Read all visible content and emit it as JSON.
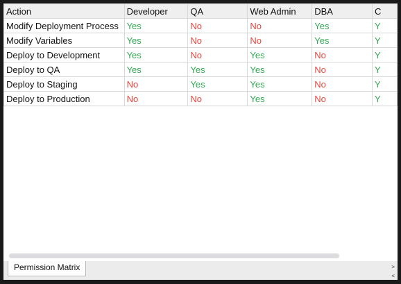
{
  "columns": [
    "Action",
    "Developer",
    "QA",
    "Web Admin",
    "DBA",
    "C"
  ],
  "rows": [
    {
      "action": "Modify Deployment Process",
      "values": [
        "Yes",
        "No",
        "No",
        "Yes",
        "Y"
      ]
    },
    {
      "action": "Modify Variables",
      "values": [
        "Yes",
        "No",
        "No",
        "Yes",
        "Y"
      ]
    },
    {
      "action": "Deploy to Development",
      "values": [
        "Yes",
        "No",
        "Yes",
        "No",
        "Y"
      ]
    },
    {
      "action": "Deploy to QA",
      "values": [
        "Yes",
        "Yes",
        "Yes",
        "No",
        "Y"
      ]
    },
    {
      "action": "Deploy to Staging",
      "values": [
        "No",
        "Yes",
        "Yes",
        "No",
        "Y"
      ]
    },
    {
      "action": "Deploy to Production",
      "values": [
        "No",
        "No",
        "Yes",
        "No",
        "Y"
      ]
    }
  ],
  "sheet_tab": "Permission Matrix",
  "nav": {
    "next": ">",
    "prev": "<"
  },
  "colors": {
    "yes": "#34a853",
    "no": "#e8453c"
  }
}
